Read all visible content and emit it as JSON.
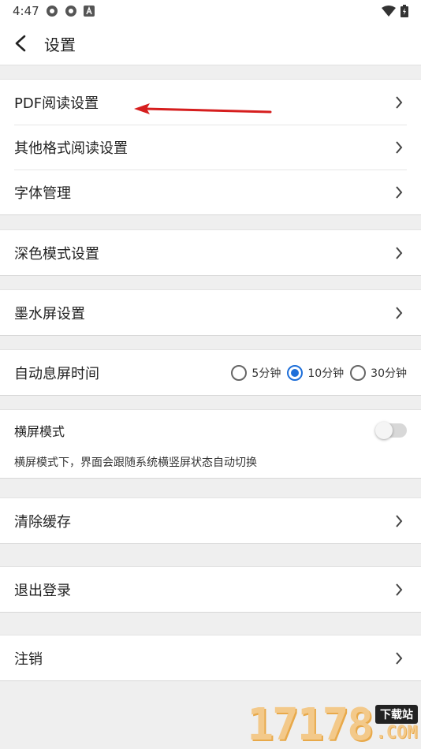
{
  "status": {
    "time": "4:47"
  },
  "header": {
    "title": "设置"
  },
  "groups": {
    "reading": [
      "PDF阅读设置",
      "其他格式阅读设置",
      "字体管理"
    ],
    "dark": "深色模式设置",
    "eink": "墨水屏设置",
    "screen_off": {
      "label": "自动息屏时间",
      "options": [
        "5分钟",
        "10分钟",
        "30分钟"
      ],
      "selected": "10分钟"
    },
    "landscape": {
      "title": "横屏模式",
      "desc": "横屏模式下，界面会跟随系统横竖屏状态自动切换",
      "enabled": false
    },
    "clear_cache": "清除缓存",
    "logout": "退出登录",
    "cancel_account": "注销"
  },
  "watermark": {
    "digits": "17178",
    "badge": "下载站",
    "com": ".COM"
  },
  "colors": {
    "accent": "#1e6fd9",
    "annotation_arrow": "#d61e1e"
  }
}
